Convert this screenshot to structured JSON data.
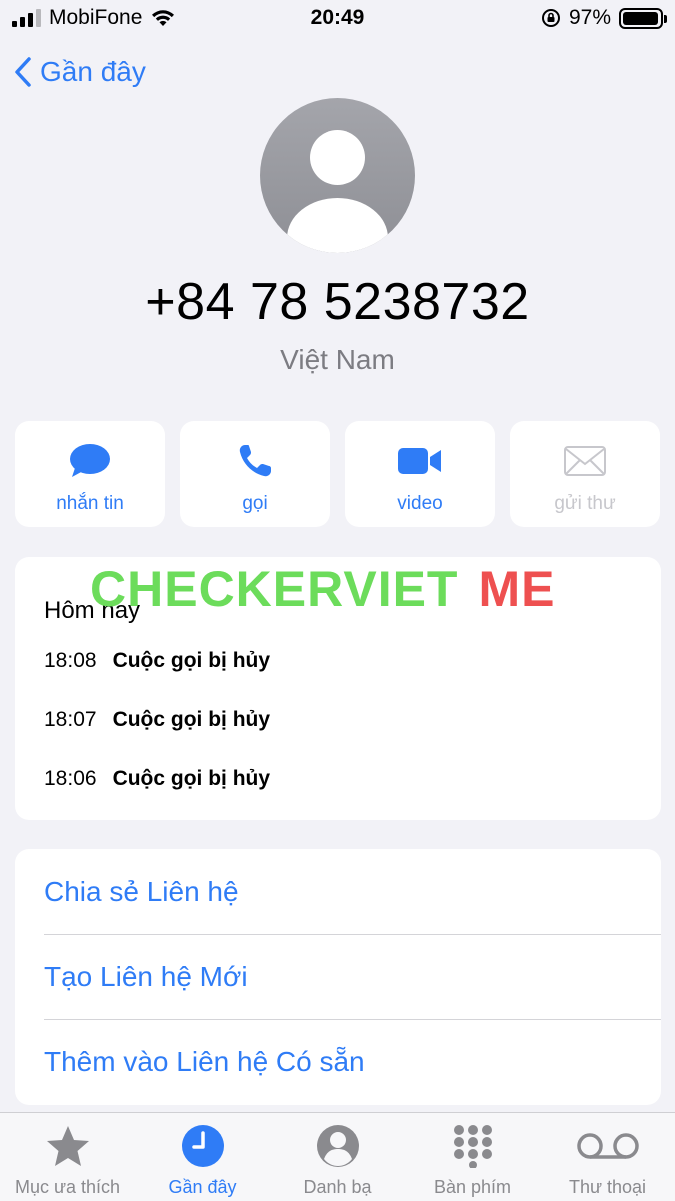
{
  "status_bar": {
    "carrier": "MobiFone",
    "time": "20:49",
    "battery": "97%",
    "battery_level": 0.97
  },
  "nav": {
    "back_label": "Gần đây"
  },
  "contact": {
    "phone_number": "+84 78 5238732",
    "country": "Việt Nam"
  },
  "actions": [
    {
      "label": "nhắn tin",
      "icon": "message-icon",
      "enabled": true
    },
    {
      "label": "gọi",
      "icon": "phone-icon",
      "enabled": true
    },
    {
      "label": "video",
      "icon": "video-icon",
      "enabled": true
    },
    {
      "label": "gửi thư",
      "icon": "mail-icon",
      "enabled": false
    }
  ],
  "recents": {
    "header": "Hôm nay",
    "calls": [
      {
        "time": "18:08",
        "description": "Cuộc gọi bị hủy"
      },
      {
        "time": "18:07",
        "description": "Cuộc gọi bị hủy"
      },
      {
        "time": "18:06",
        "description": "Cuộc gọi bị hủy"
      }
    ]
  },
  "watermark": {
    "part1": "CHECKERVIET",
    "part2": "ME"
  },
  "menu": {
    "items": [
      "Chia sẻ Liên hệ",
      "Tạo Liên hệ Mới",
      "Thêm vào Liên hệ Có sẵn"
    ]
  },
  "tab_bar": {
    "items": [
      {
        "label": "Mục ưa thích",
        "icon": "star-icon",
        "active": false
      },
      {
        "label": "Gần đây",
        "icon": "clock-icon",
        "active": true
      },
      {
        "label": "Danh bạ",
        "icon": "person-icon",
        "active": false
      },
      {
        "label": "Bàn phím",
        "icon": "keypad-icon",
        "active": false
      },
      {
        "label": "Thư thoại",
        "icon": "voicemail-icon",
        "active": false
      }
    ]
  },
  "colors": {
    "accent": "#2f7cf6",
    "background": "#f2f2f7",
    "disabled": "#c7c7cc"
  }
}
